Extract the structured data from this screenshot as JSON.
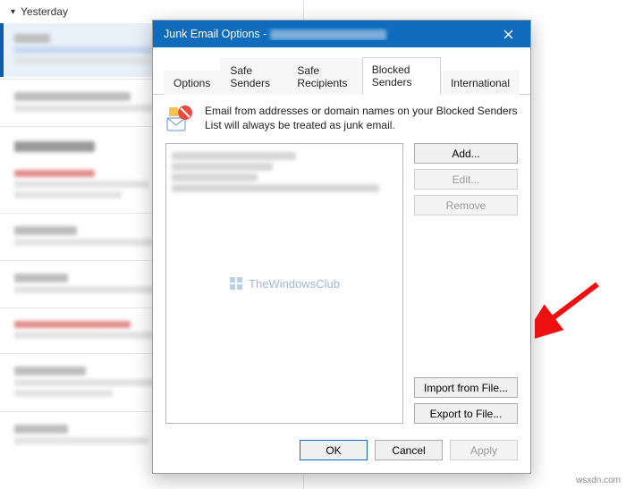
{
  "mail": {
    "section_header": "Yesterday"
  },
  "dialog": {
    "title_prefix": "Junk Email Options - ",
    "tabs": {
      "options": "Options",
      "safe_senders": "Safe Senders",
      "safe_recipients": "Safe Recipients",
      "blocked_senders": "Blocked Senders",
      "international": "International"
    },
    "info_text": "Email from addresses or domain names on your Blocked Senders List will always be treated as junk email.",
    "buttons": {
      "add": "Add...",
      "edit": "Edit...",
      "remove": "Remove",
      "import": "Import from File...",
      "export": "Export to File...",
      "ok": "OK",
      "cancel": "Cancel",
      "apply": "Apply"
    }
  },
  "watermark": "TheWindowsClub",
  "credit": "wsxdn.com"
}
